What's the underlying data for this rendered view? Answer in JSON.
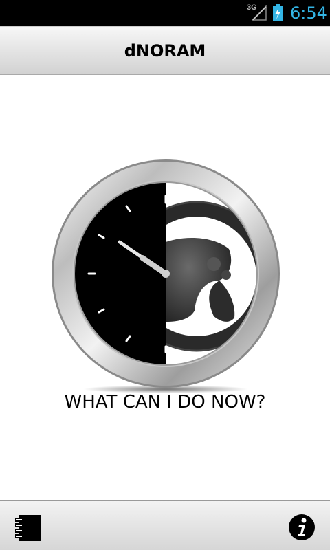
{
  "status_bar": {
    "network": "3G",
    "time": "6:54",
    "signal_icon": "signal-icon",
    "battery_icon": "battery-charging-icon"
  },
  "app": {
    "title": "dNORAM"
  },
  "main": {
    "logo_icon": "clock-steering-wheel-logo",
    "headline": "WHAT CAN I DO NOW?"
  },
  "bottom_bar": {
    "left_icon": "notebook-icon",
    "right_icon": "info-icon"
  },
  "colors": {
    "status_time": "#33b5e5",
    "status_background": "#000000"
  }
}
